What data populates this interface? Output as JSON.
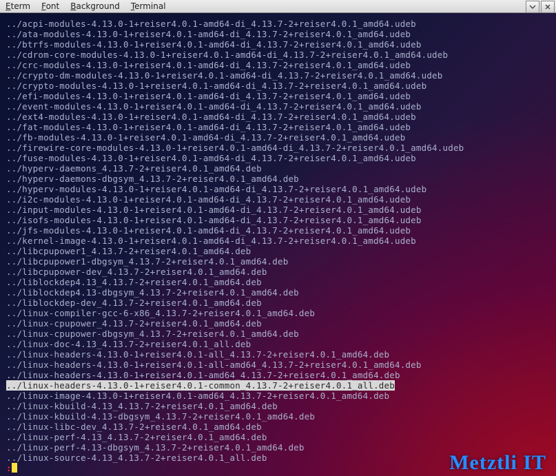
{
  "menu": {
    "items": [
      {
        "label": "Eterm",
        "accel": "E"
      },
      {
        "label": "Font",
        "accel": "F"
      },
      {
        "label": "Background",
        "accel": "B"
      },
      {
        "label": "Terminal",
        "accel": "T"
      }
    ]
  },
  "window_controls": {
    "tooltip_shade": "Shade",
    "tooltip_close": "Close"
  },
  "watermark": "Metztli IT",
  "listing": [
    "",
    "../acpi-modules-4.13.0-1+reiser4.0.1-amd64-di_4.13.7-2+reiser4.0.1_amd64.udeb",
    "../ata-modules-4.13.0-1+reiser4.0.1-amd64-di_4.13.7-2+reiser4.0.1_amd64.udeb",
    "../btrfs-modules-4.13.0-1+reiser4.0.1-amd64-di_4.13.7-2+reiser4.0.1_amd64.udeb",
    "../cdrom-core-modules-4.13.0-1+reiser4.0.1-amd64-di_4.13.7-2+reiser4.0.1_amd64.udeb",
    "../crc-modules-4.13.0-1+reiser4.0.1-amd64-di_4.13.7-2+reiser4.0.1_amd64.udeb",
    "../crypto-dm-modules-4.13.0-1+reiser4.0.1-amd64-di_4.13.7-2+reiser4.0.1_amd64.udeb",
    "../crypto-modules-4.13.0-1+reiser4.0.1-amd64-di_4.13.7-2+reiser4.0.1_amd64.udeb",
    "../efi-modules-4.13.0-1+reiser4.0.1-amd64-di_4.13.7-2+reiser4.0.1_amd64.udeb",
    "../event-modules-4.13.0-1+reiser4.0.1-amd64-di_4.13.7-2+reiser4.0.1_amd64.udeb",
    "../ext4-modules-4.13.0-1+reiser4.0.1-amd64-di_4.13.7-2+reiser4.0.1_amd64.udeb",
    "../fat-modules-4.13.0-1+reiser4.0.1-amd64-di_4.13.7-2+reiser4.0.1_amd64.udeb",
    "../fb-modules-4.13.0-1+reiser4.0.1-amd64-di_4.13.7-2+reiser4.0.1_amd64.udeb",
    "../firewire-core-modules-4.13.0-1+reiser4.0.1-amd64-di_4.13.7-2+reiser4.0.1_amd64.udeb",
    "../fuse-modules-4.13.0-1+reiser4.0.1-amd64-di_4.13.7-2+reiser4.0.1_amd64.udeb",
    "../hyperv-daemons_4.13.7-2+reiser4.0.1_amd64.deb",
    "../hyperv-daemons-dbgsym_4.13.7-2+reiser4.0.1_amd64.deb",
    "../hyperv-modules-4.13.0-1+reiser4.0.1-amd64-di_4.13.7-2+reiser4.0.1_amd64.udeb",
    "../i2c-modules-4.13.0-1+reiser4.0.1-amd64-di_4.13.7-2+reiser4.0.1_amd64.udeb",
    "../input-modules-4.13.0-1+reiser4.0.1-amd64-di_4.13.7-2+reiser4.0.1_amd64.udeb",
    "../isofs-modules-4.13.0-1+reiser4.0.1-amd64-di_4.13.7-2+reiser4.0.1_amd64.udeb",
    "../jfs-modules-4.13.0-1+reiser4.0.1-amd64-di_4.13.7-2+reiser4.0.1_amd64.udeb",
    "../kernel-image-4.13.0-1+reiser4.0.1-amd64-di_4.13.7-2+reiser4.0.1_amd64.udeb",
    "../libcpupower1_4.13.7-2+reiser4.0.1_amd64.deb",
    "../libcpupower1-dbgsym_4.13.7-2+reiser4.0.1_amd64.deb",
    "../libcpupower-dev_4.13.7-2+reiser4.0.1_amd64.deb",
    "../liblockdep4.13_4.13.7-2+reiser4.0.1_amd64.deb",
    "../liblockdep4.13-dbgsym_4.13.7-2+reiser4.0.1_amd64.deb",
    "../liblockdep-dev_4.13.7-2+reiser4.0.1_amd64.deb",
    "../linux-compiler-gcc-6-x86_4.13.7-2+reiser4.0.1_amd64.deb",
    "../linux-cpupower_4.13.7-2+reiser4.0.1_amd64.deb",
    "../linux-cpupower-dbgsym_4.13.7-2+reiser4.0.1_amd64.deb",
    "../linux-doc-4.13_4.13.7-2+reiser4.0.1_all.deb",
    "../linux-headers-4.13.0-1+reiser4.0.1-all_4.13.7-2+reiser4.0.1_amd64.deb",
    "../linux-headers-4.13.0-1+reiser4.0.1-all-amd64_4.13.7-2+reiser4.0.1_amd64.deb",
    "../linux-headers-4.13.0-1+reiser4.0.1-amd64_4.13.7-2+reiser4.0.1_amd64.deb",
    "../linux-headers-4.13.0-1+reiser4.0.1-common_4.13.7-2+reiser4.0.1_all.deb",
    "../linux-image-4.13.0-1+reiser4.0.1-amd64_4.13.7-2+reiser4.0.1_amd64.deb",
    "../linux-kbuild-4.13_4.13.7-2+reiser4.0.1_amd64.deb",
    "../linux-kbuild-4.13-dbgsym_4.13.7-2+reiser4.0.1_amd64.deb",
    "../linux-libc-dev_4.13.7-2+reiser4.0.1_amd64.deb",
    "../linux-perf-4.13_4.13.7-2+reiser4.0.1_amd64.deb",
    "../linux-perf-4.13-dbgsym_4.13.7-2+reiser4.0.1_amd64.deb",
    "../linux-source-4.13_4.13.7-2+reiser4.0.1_all.deb"
  ],
  "selected_index": 36,
  "prompt": ":"
}
